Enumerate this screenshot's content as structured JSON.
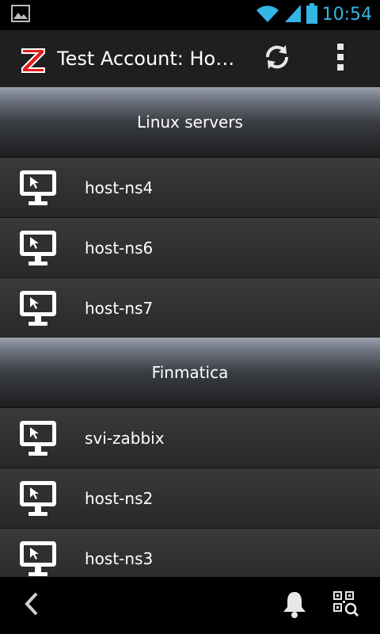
{
  "status_bar": {
    "time": "10:54",
    "icons": [
      "image-notification-icon",
      "wifi-icon",
      "signal-icon",
      "battery-icon"
    ],
    "accent_color": "#33b5e5"
  },
  "action_bar": {
    "title": "Test Account: Hosts",
    "app_icon": "zabbix-z-logo",
    "actions": [
      "refresh-icon",
      "overflow-menu-icon"
    ]
  },
  "groups": [
    {
      "name": "Linux servers",
      "hosts": [
        "host-ns4",
        "host-ns6",
        "host-ns7"
      ]
    },
    {
      "name": "Finmatica",
      "hosts": [
        "svi-zabbix",
        "host-ns2",
        "host-ns3"
      ]
    }
  ],
  "bottom_bar": {
    "icons": [
      "back-icon",
      "notification-bell-icon",
      "qr-scan-icon"
    ]
  }
}
